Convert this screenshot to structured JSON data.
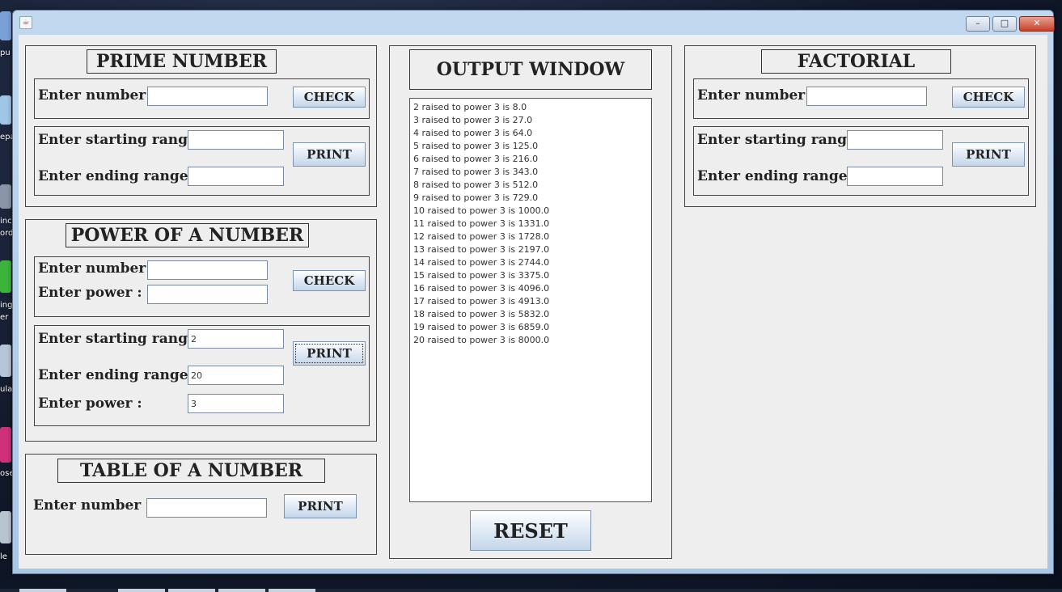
{
  "prime": {
    "heading": "PRIME NUMBER",
    "number_label": "Enter number :",
    "number_value": "",
    "check_label": "CHECK",
    "start_label": "Enter starting range :",
    "start_value": "",
    "end_label": "Enter ending range :",
    "end_value": "",
    "print_label": "PRINT"
  },
  "power": {
    "heading": "POWER OF A NUMBER",
    "number_label": "Enter number :",
    "number_value": "",
    "power_label": "Enter power :",
    "power_value": "",
    "check_label": "CHECK",
    "start_label": "Enter starting range :",
    "start_value": "2",
    "end_label": "Enter ending range :",
    "end_value": "20",
    "range_power_label": "Enter power :",
    "range_power_value": "3",
    "print_label": "PRINT"
  },
  "table": {
    "heading": "TABLE OF A NUMBER",
    "number_label": "Enter number :",
    "number_value": "",
    "print_label": "PRINT"
  },
  "output": {
    "heading": "OUTPUT WINDOW",
    "lines": [
      "2 raised to power 3 is 8.0",
      "3 raised to power 3 is 27.0",
      "4 raised to power 3 is 64.0",
      "5 raised to power 3 is 125.0",
      "6 raised to power 3 is 216.0",
      "7 raised to power 3 is 343.0",
      "8 raised to power 3 is 512.0",
      "9 raised to power 3 is 729.0",
      "10 raised to power 3 is 1000.0",
      "11 raised to power 3 is 1331.0",
      "12 raised to power 3 is 1728.0",
      "13 raised to power 3 is 2197.0",
      "14 raised to power 3 is 2744.0",
      "15 raised to power 3 is 3375.0",
      "16 raised to power 3 is 4096.0",
      "17 raised to power 3 is 4913.0",
      "18 raised to power 3 is 5832.0",
      "19 raised to power 3 is 6859.0",
      "20 raised to power 3 is 8000.0"
    ],
    "reset_label": "RESET"
  },
  "factorial": {
    "heading": "FACTORIAL",
    "number_label": "Enter number :",
    "number_value": "",
    "check_label": "CHECK",
    "start_label": "Enter starting range :",
    "start_value": "",
    "end_label": "Enter ending range :",
    "end_value": "",
    "print_label": "PRINT"
  },
  "window": {
    "minimize": "–",
    "maximize": "□",
    "close": "✕",
    "app_icon": "java-icon"
  },
  "desktop": {
    "labels": [
      "pu",
      "epa",
      "inc",
      "ord",
      "ing",
      "er",
      "ula",
      "ose",
      "le"
    ]
  }
}
